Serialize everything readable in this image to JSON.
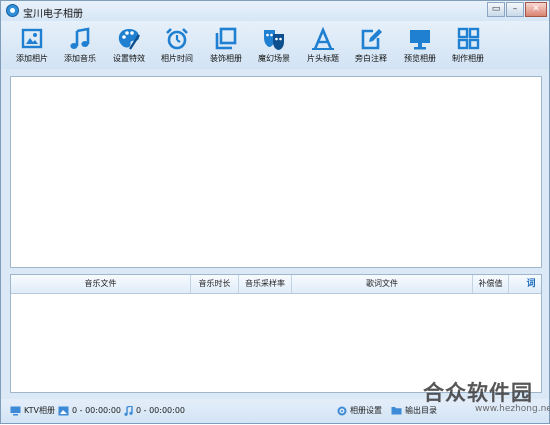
{
  "window": {
    "title": "宝川电子相册"
  },
  "toolbar": {
    "items": [
      {
        "label": "添加相片",
        "icon": "add-photo-icon"
      },
      {
        "label": "添加音乐",
        "icon": "music-note-icon"
      },
      {
        "label": "设置特效",
        "icon": "palette-icon"
      },
      {
        "label": "相片时间",
        "icon": "alarm-clock-icon"
      },
      {
        "label": "装饰相册",
        "icon": "layers-icon"
      },
      {
        "label": "魔幻场景",
        "icon": "theater-mask-icon"
      },
      {
        "label": "片头标题",
        "icon": "title-a-icon"
      },
      {
        "label": "旁白注释",
        "icon": "edit-note-icon"
      },
      {
        "label": "预览相册",
        "icon": "monitor-icon"
      },
      {
        "label": "制作相册",
        "icon": "grid-icon"
      }
    ]
  },
  "music_table": {
    "columns": [
      "音乐文件",
      "音乐时长",
      "音乐采样率",
      "歌词文件",
      "补偿值"
    ],
    "lyric_button": "词",
    "rows": []
  },
  "statusbar": {
    "ktv": "KTV相册",
    "photo_stats": "0 - 00:00:00",
    "music_stats": "0 - 00:00:00",
    "album_settings": "相册设置",
    "output_dir": "输出目录"
  },
  "watermark": {
    "brand": "合众软件园",
    "url": "www.hezhong.net"
  },
  "colors": {
    "accent": "#1f7fd0",
    "bg": "#dbe9f7"
  }
}
